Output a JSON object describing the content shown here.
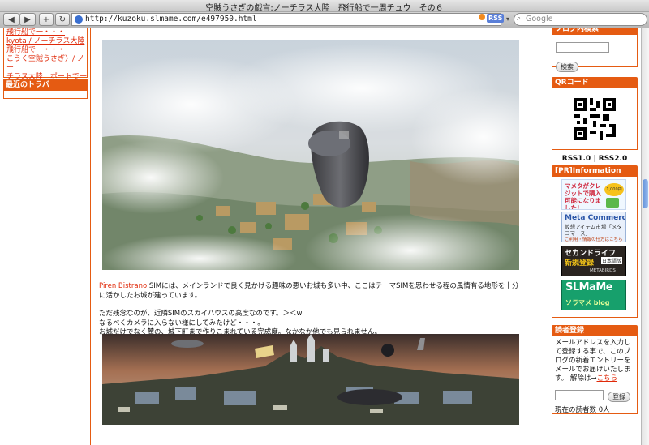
{
  "browser": {
    "title": "空賊うさぎの戯言:ノーチラス大陸　飛行船で一周チュウ　その６",
    "url": "http://kuzoku.slmame.com/e497950.html",
    "rss_label": "RSS",
    "search_placeholder": "Google",
    "back_label": "◀",
    "forward_label": "▶",
    "add_label": "+",
    "reload_label": "↻"
  },
  "left": {
    "links": [
      "飛行船で一・・・",
      "kyota / ノーチラス大陸",
      "飛行船で一・・・",
      "こうく空賊うさぎ〉/ ノー",
      "チラス大陸　ポートで一周"
    ],
    "recent_trackback_header": "最近のトラバ"
  },
  "main": {
    "paragraph1_link": "Piren Bistrano",
    "paragraph1_text": " SIMには、メインランドで良く見かける趣味の悪いお城も多い中、ここはテーマSIMを思わせる程の風情有る地形を十分に活かしたお城が建っています。",
    "paragraph2_line1": "ただ残念なのが、近隣SIMのスカイハウスの高度なのです。＞＜w",
    "paragraph2_line2": "なるべくカメラに入らない様にしてみたけど・・・。",
    "paragraph2_line3": "お城だけでなく麓の、城下町まで作りこまれている完成度。なかなか他でも見られません。"
  },
  "right": {
    "blog_search_header": "ブログ内検索",
    "search_button": "検索",
    "qr_header": "QRコード",
    "rss1": "RSS1.0",
    "rss2": "RSS2.0",
    "pr_header": "[PR]Information",
    "banner1_text": "マメタがクレジットで購入可能になりました！",
    "banner1_price": "1,000円から",
    "banner2_title": "Meta Commerce",
    "banner2_sub": "仮想アイテム市場「メタコマース」",
    "banner2_foot": "ご利用・情報の仕方はこちら",
    "banner3_title": "セカンドライフ",
    "banner3_sub": "新規登録",
    "banner3_badge": "日本語版",
    "banner3_foot": "METABIRDS",
    "banner4_title": "SLMaMe",
    "banner4_sub": "ソラマメ blog",
    "reader_header": "読者登録",
    "reader_desc": "メールアドレスを入力して登録する事で、このブログの新着エントリーをメールでお届けいたします。 解除は→",
    "reader_link": "こちら",
    "register_button": "登録",
    "reader_count": "現在の読者数 0人"
  },
  "colors": {
    "accent": "#e55b12",
    "link": "#e02a0a"
  }
}
